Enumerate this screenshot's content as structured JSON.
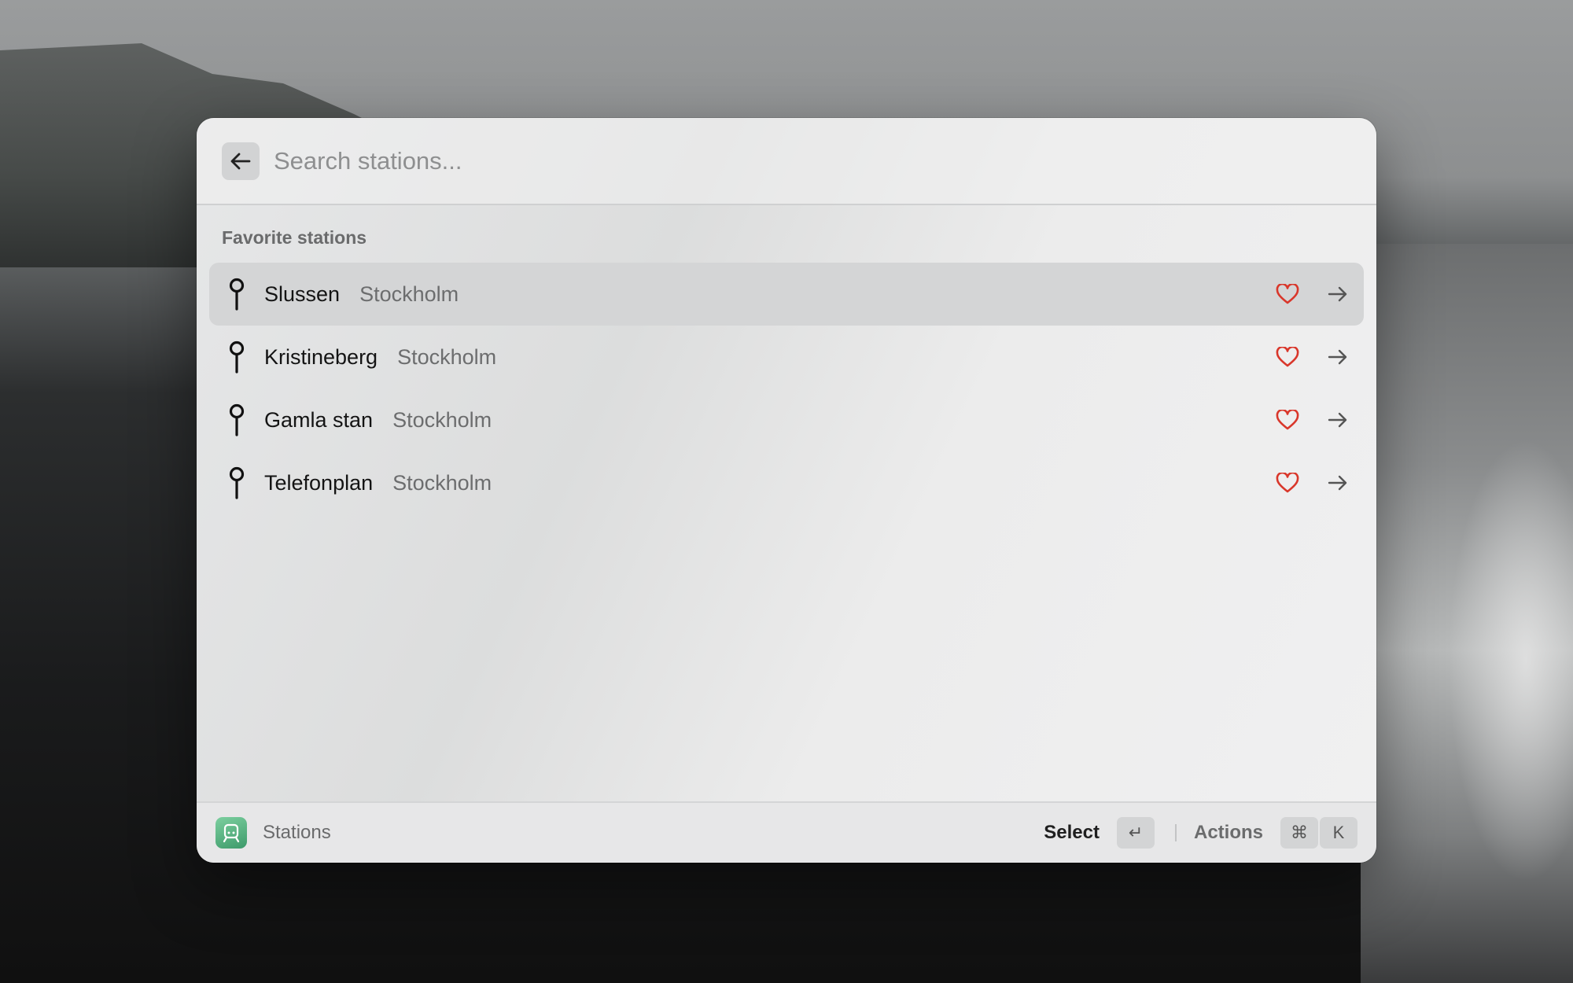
{
  "search": {
    "placeholder": "Search stations...",
    "value": ""
  },
  "section": {
    "title": "Favorite stations"
  },
  "stations": [
    {
      "name": "Slussen",
      "city": "Stockholm",
      "selected": true,
      "favorite": true
    },
    {
      "name": "Kristineberg",
      "city": "Stockholm",
      "selected": false,
      "favorite": true
    },
    {
      "name": "Gamla stan",
      "city": "Stockholm",
      "selected": false,
      "favorite": true
    },
    {
      "name": "Telefonplan",
      "city": "Stockholm",
      "selected": false,
      "favorite": true
    }
  ],
  "footer": {
    "app_name": "Stations",
    "select_label": "Select",
    "select_key": "↵",
    "actions_label": "Actions",
    "actions_keys": [
      "⌘",
      "K"
    ]
  },
  "colors": {
    "heart": "#d9372b",
    "selected_row": "#d4d5d6",
    "app_icon": "#4fae7a"
  },
  "icons": {
    "back": "arrow-left-icon",
    "station": "map-pin-icon",
    "favorite": "heart-icon",
    "open": "arrow-right-icon",
    "app": "train-icon"
  }
}
